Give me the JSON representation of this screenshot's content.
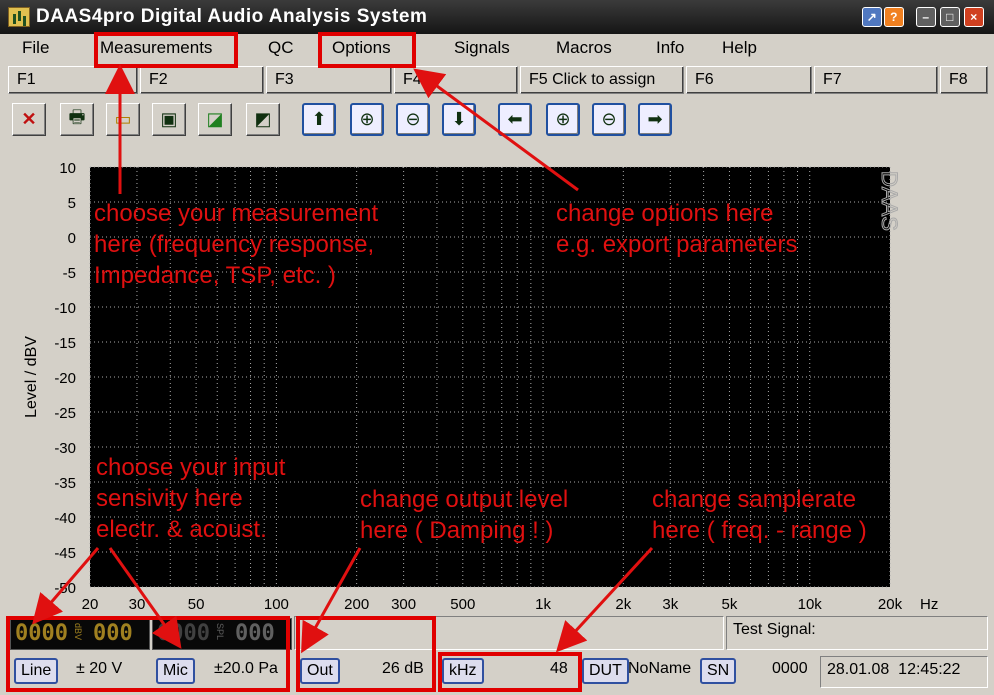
{
  "window": {
    "title": "DAAS4pro Digital Audio Analysis System"
  },
  "menu": [
    "File",
    "Measurements",
    "QC",
    "Options",
    "Signals",
    "Macros",
    "Info",
    "Help"
  ],
  "fkeys": [
    "F1",
    "F2",
    "F3",
    "F4",
    "F5  Click to assign",
    "F6",
    "F7",
    "F8"
  ],
  "toolbar_icons": [
    "cancel-icon",
    "print-icon",
    "open-icon",
    "save-icon",
    "export-icon",
    "import-icon",
    "arrow-up-icon",
    "zoom-in-icon",
    "zoom-out-icon",
    "arrow-down-icon",
    "arrow-left-icon",
    "zoom-in-h-icon",
    "zoom-out-h-icon",
    "arrow-right-icon"
  ],
  "chart_data": {
    "type": "line",
    "ylabel": "Level / dBV",
    "xunit": "Hz",
    "watermark": "DAAS",
    "ylim": [
      -50,
      10
    ],
    "xlim": [
      20,
      20000
    ],
    "xscale": "log",
    "yticks": [
      "10",
      "5",
      "0",
      "-5",
      "-10",
      "-15",
      "-20",
      "-25",
      "-30",
      "-35",
      "-40",
      "-45",
      "-50"
    ],
    "xticks": [
      {
        "v": 20,
        "l": "20"
      },
      {
        "v": 30,
        "l": "30"
      },
      {
        "v": 50,
        "l": "50"
      },
      {
        "v": 100,
        "l": "100"
      },
      {
        "v": 200,
        "l": "200"
      },
      {
        "v": 300,
        "l": "300"
      },
      {
        "v": 500,
        "l": "500"
      },
      {
        "v": 1000,
        "l": "1k"
      },
      {
        "v": 2000,
        "l": "2k"
      },
      {
        "v": 3000,
        "l": "3k"
      },
      {
        "v": 5000,
        "l": "5k"
      },
      {
        "v": 10000,
        "l": "10k"
      },
      {
        "v": 20000,
        "l": "20k"
      }
    ],
    "grid": true,
    "series": []
  },
  "status": {
    "led_left": "0000",
    "led_left_unit": "dBV",
    "led_left_2": "000",
    "led_right": "0000",
    "led_right_unit": "SPL",
    "led_right_2": "000",
    "test_signal": "Test Signal:",
    "line_btn": "Line",
    "line_value": "± 20 V",
    "mic_btn": "Mic",
    "mic_value": "±20.0 Pa",
    "out_btn": "Out",
    "out_value": "26 dB",
    "khz_btn": "kHz",
    "khz_value": "48",
    "dut_btn": "DUT",
    "dut_value": "NoName",
    "sn_btn": "SN",
    "sn_value": "0000",
    "date": "28.01.08",
    "time": "12:45:22"
  },
  "annotations": {
    "measurement": "choose your measurement\nhere (frequency response,\nImpedance, TSP, etc. )",
    "options": "change options here\ne.g. export parameters",
    "input": "choose your input\nsensivity here\nelectr. & acoust.",
    "output": "change output level\nhere ( Damping ! )",
    "samplerate": "change samplerate\nhere ( freq. - range )",
    "color": "#e01010"
  }
}
